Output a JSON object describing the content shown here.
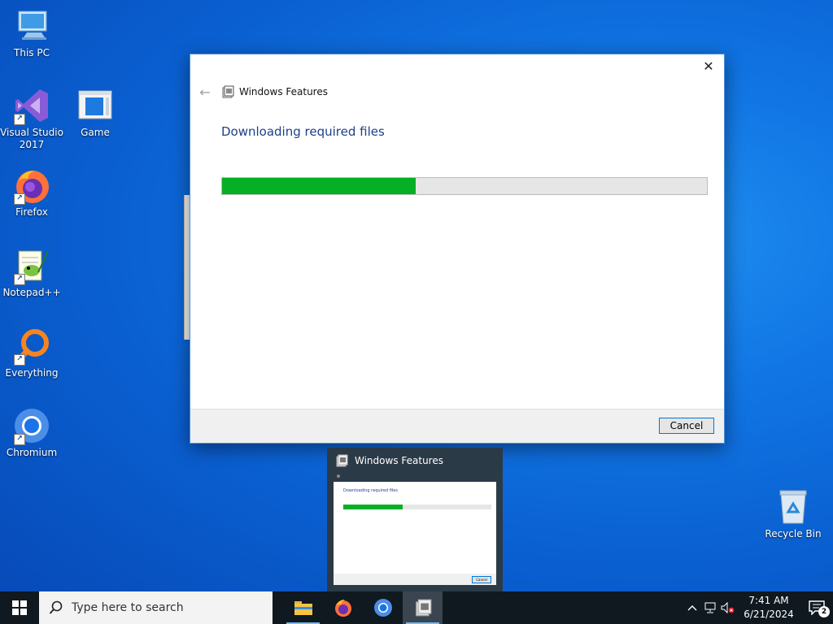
{
  "desktop": {
    "icons": [
      {
        "label": "This PC"
      },
      {
        "label": "Visual Studio\n2017"
      },
      {
        "label": "Game"
      },
      {
        "label": "Firefox"
      },
      {
        "label": "Notepad++"
      },
      {
        "label": "Everything"
      },
      {
        "label": "Chromium"
      },
      {
        "label": "Recycle Bin"
      }
    ]
  },
  "dialog": {
    "window_title": "Windows Features",
    "heading": "Downloading required files",
    "progress_percent": 40,
    "cancel_label": "Cancel",
    "close_glyph": "✕",
    "back_glyph": "←"
  },
  "preview": {
    "title": "Windows Features",
    "thumb_heading": "Downloading required files",
    "thumb_cancel": "Cancel"
  },
  "taskbar": {
    "search_placeholder": "Type here to search",
    "apps": [
      "file-explorer",
      "firefox",
      "chromium",
      "windows-features"
    ],
    "time": "7:41 AM",
    "date": "6/21/2024",
    "notification_count": "2"
  },
  "colors": {
    "progress_green": "#06b025",
    "accent_blue": "#0078d7",
    "heading_blue": "#1e3f8a"
  }
}
